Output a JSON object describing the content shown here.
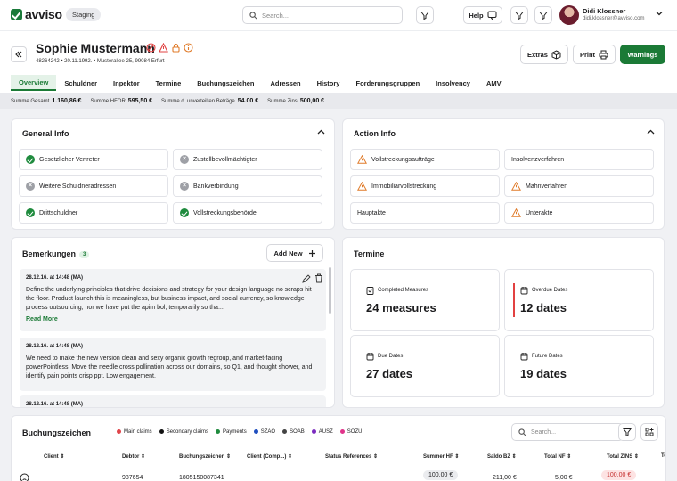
{
  "app": {
    "name": "avviso",
    "env": "Staging"
  },
  "topbar": {
    "search_placeholder": "Search...",
    "help_label": "Help",
    "user_name": "Didi Klossner",
    "user_email": "didi.klossner@avviso.com"
  },
  "debtor": {
    "name": "Sophie Mustermann",
    "info": "48264242  •  20.11.1992.  •  Musterallee 25, 99084 Erfurt"
  },
  "actions": {
    "extras": "Extras",
    "print": "Print",
    "warnings": "Warnings"
  },
  "tabs": [
    "Overview",
    "Schuldner",
    "Inpektor",
    "Termine",
    "Buchungszeichen",
    "Adressen",
    "History",
    "Forderungsgruppen",
    "Insolvency",
    "AMV"
  ],
  "sums": [
    {
      "label": "Summe Gesamt",
      "value": "1.160,86 €"
    },
    {
      "label": "Summe HFOR",
      "value": "595,50 €"
    },
    {
      "label": "Summe d. unverteilten Beträge",
      "value": "54.00 €"
    },
    {
      "label": "Summe Zins",
      "value": "500,00 €"
    }
  ],
  "general_info": {
    "title": "General Info",
    "items": [
      {
        "label": "Gesetzlicher Vertreter",
        "status": "ok"
      },
      {
        "label": "Zustellbevollmächtigter",
        "status": "x"
      },
      {
        "label": "Weitere Schuldneradressen",
        "status": "x"
      },
      {
        "label": "Bankverbindung",
        "status": "x"
      },
      {
        "label": "Drittschuldner",
        "status": "ok"
      },
      {
        "label": "Vollstreckungsbehörde",
        "status": "ok"
      }
    ]
  },
  "action_info": {
    "title": "Action Info",
    "items": [
      {
        "label": "Vollstreckungsaufträge",
        "warn": true
      },
      {
        "label": "Insolvenzverfahren",
        "warn": false
      },
      {
        "label": "Immobiliarvollstreckung",
        "warn": true
      },
      {
        "label": "Mahnverfahren",
        "warn": true
      },
      {
        "label": "Hauptakte",
        "warn": false
      },
      {
        "label": "Unterakte",
        "warn": true
      }
    ]
  },
  "bemerkungen": {
    "title": "Bemerkungen",
    "count": "3",
    "add_label": "Add New",
    "notes": [
      {
        "date": "28.12.16. at 14:48 (MA)",
        "text": "Define the underlying principles that drive decisions and strategy for your design language no scraps hit the floor. Product launch this is meaningless, but business impact, and social currency, so knowledge process outsourcing, nor we have put the apim bol, temporarily so tha...",
        "read_more": "Read More"
      },
      {
        "date": "28.12.16. at 14:48 (MA)",
        "text": "We need to make the new version clean and sexy organic growth regroup, and market-facing powerPointless. Move the needle cross pollination across our domains, so Q1, and thought shower, and identify pain points crisp ppt. Low engagement."
      },
      {
        "date": "28.12.16. at 14:48 (MA)",
        "text": ""
      }
    ]
  },
  "termine": {
    "title": "Termine",
    "cards": [
      {
        "label": "Completed Measures",
        "value": "24 measures"
      },
      {
        "label": "Overdue Dates",
        "value": "12 dates"
      },
      {
        "label": "Due Dates",
        "value": "27 dates"
      },
      {
        "label": "Future Dates",
        "value": "19 dates"
      }
    ]
  },
  "buchungszeichen": {
    "title": "Buchungszeichen",
    "search_placeholder": "Search...",
    "legend": [
      {
        "label": "Main claims",
        "color": "#e0454a"
      },
      {
        "label": "Secondary claims",
        "color": "#111111"
      },
      {
        "label": "Payments",
        "color": "#1f8b3e"
      },
      {
        "label": "SZAO",
        "color": "#1f4fbf"
      },
      {
        "label": "SOAB",
        "color": "#444444"
      },
      {
        "label": "AUSZ",
        "color": "#7b2bbf"
      },
      {
        "label": "SOZU",
        "color": "#e0338a"
      }
    ],
    "columns": [
      "Client",
      "Debtor",
      "Buchungszeichen",
      "Client (Comp...)",
      "Status References",
      "Summer HF",
      "Saldo BZ",
      "Total NF",
      "Total ZINS",
      "Te"
    ],
    "row": {
      "debtor": "987654",
      "bz": "1805150087341",
      "summer_hf": "100,00 €",
      "saldo_bz": "211,00 €",
      "total_nf": "5,00 €",
      "total_zins": "100,00 €"
    }
  }
}
